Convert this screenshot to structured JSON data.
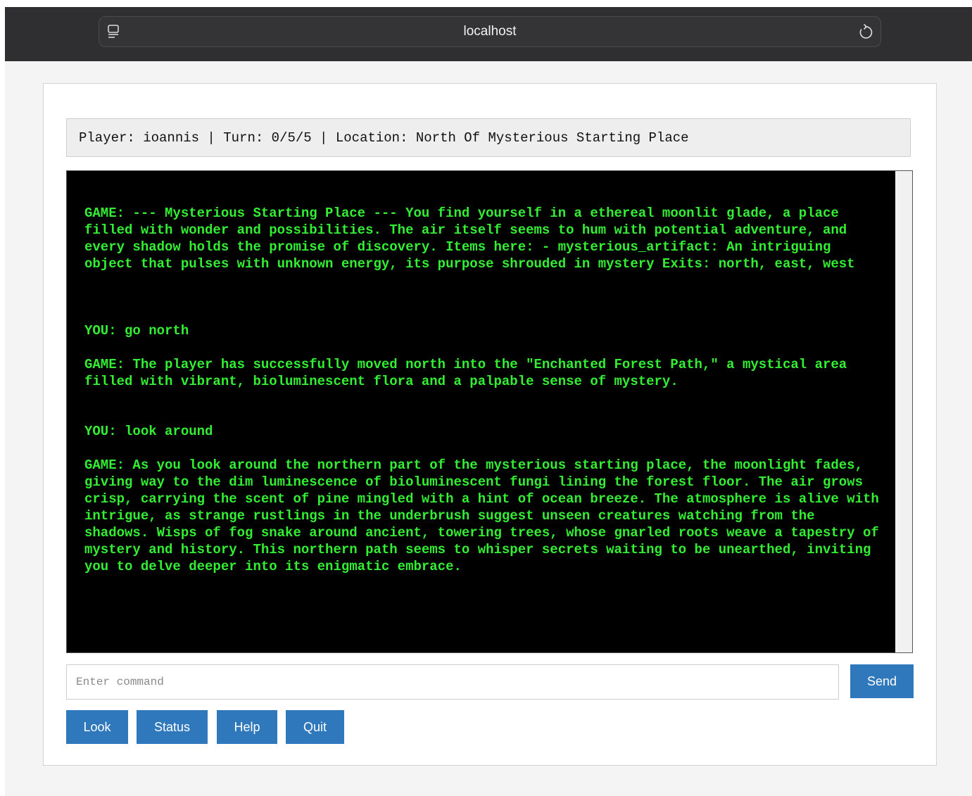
{
  "browser": {
    "url": "localhost",
    "left_icon": "reader-icon",
    "right_icon": "reload-icon"
  },
  "status": {
    "text": "Player: ioannis | Turn: 0/5/5 | Location: North Of Mysterious Starting Place"
  },
  "log": {
    "messages": [
      "GAME: --- Mysterious Starting Place --- You find yourself in a ethereal moonlit glade, a place filled with wonder and possibilities. The air itself seems to hum with potential adventure, and every shadow holds the promise of discovery. Items here: - mysterious_artifact: An intriguing object that pulses with unknown energy, its purpose shrouded in mystery Exits: north, east, west",
      "YOU: go north",
      "GAME: The player has successfully moved north into the \"Enchanted Forest Path,\" a mystical area filled with vibrant, bioluminescent flora and a palpable sense of mystery.",
      "YOU: look around",
      "GAME: As you look around the northern part of the mysterious starting place, the moonlight fades, giving way to the dim luminescence of bioluminescent fungi lining the forest floor. The air grows crisp, carrying the scent of pine mingled with a hint of ocean breeze. The atmosphere is alive with intrigue, as strange rustlings in the underbrush suggest unseen creatures watching from the shadows. Wisps of fog snake around ancient, towering trees, whose gnarled roots weave a tapestry of mystery and history. This northern path seems to whisper secrets waiting to be unearthed, inviting you to delve deeper into its enigmatic embrace."
    ]
  },
  "input": {
    "placeholder": "Enter command",
    "value": ""
  },
  "buttons": {
    "send": "Send",
    "look": "Look",
    "status": "Status",
    "help": "Help",
    "quit": "Quit"
  },
  "colors": {
    "terminal_bg": "#000000",
    "terminal_text": "#33ee33",
    "button_bg": "#2f78bc",
    "browser_bar": "#2f2f31"
  }
}
